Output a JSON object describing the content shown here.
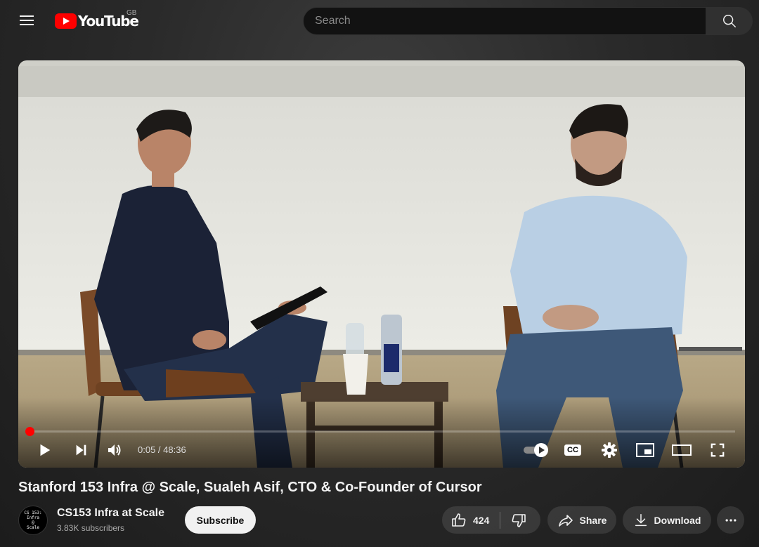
{
  "header": {
    "logo_text": "YouTube",
    "region": "GB",
    "search_placeholder": "Search"
  },
  "player": {
    "current_time": "0:05",
    "duration": "48:36",
    "time_display": "0:05 / 48:36",
    "progress_fraction": 0.0017,
    "cc_label": "CC",
    "accent_color": "#ff0000"
  },
  "video": {
    "title": "Stanford 153 Infra @ Scale, Sualeh Asif, CTO & Co-Founder of Cursor"
  },
  "channel": {
    "name": "CS153 Infra at Scale",
    "subscribers": "3.83K subscribers",
    "avatar_text": "CS 153:\nInfra\n@\nScale",
    "subscribe_label": "Subscribe"
  },
  "actions": {
    "like_count": "424",
    "share_label": "Share",
    "download_label": "Download"
  },
  "icons": [
    "menu-icon",
    "search-icon",
    "play-icon",
    "next-icon",
    "volume-icon",
    "autoplay-toggle-icon",
    "cc-icon",
    "settings-icon",
    "miniplayer-icon",
    "theater-icon",
    "fullscreen-icon",
    "like-icon",
    "dislike-icon",
    "share-icon",
    "download-icon",
    "more-icon"
  ]
}
